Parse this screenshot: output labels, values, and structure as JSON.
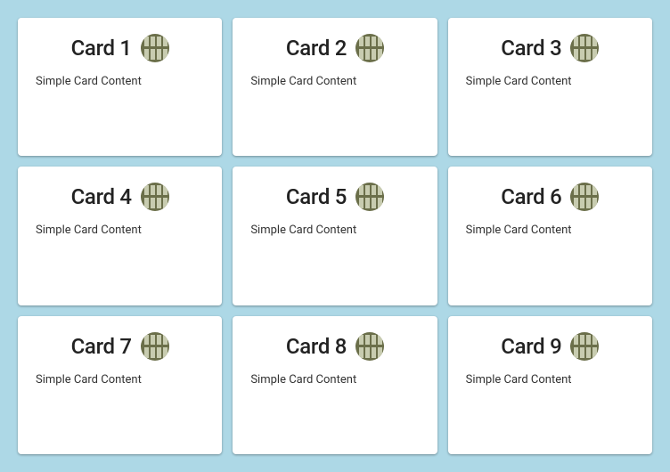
{
  "cards": [
    {
      "title": "Card 1",
      "content": "Simple Card Content",
      "avatar_icon": "window-pane-icon"
    },
    {
      "title": "Card 2",
      "content": "Simple Card Content",
      "avatar_icon": "window-pane-icon"
    },
    {
      "title": "Card 3",
      "content": "Simple Card Content",
      "avatar_icon": "window-pane-icon"
    },
    {
      "title": "Card 4",
      "content": "Simple Card Content",
      "avatar_icon": "window-pane-icon"
    },
    {
      "title": "Card 5",
      "content": "Simple Card Content",
      "avatar_icon": "window-pane-icon"
    },
    {
      "title": "Card 6",
      "content": "Simple Card Content",
      "avatar_icon": "window-pane-icon"
    },
    {
      "title": "Card 7",
      "content": "Simple Card Content",
      "avatar_icon": "window-pane-icon"
    },
    {
      "title": "Card 8",
      "content": "Simple Card Content",
      "avatar_icon": "window-pane-icon"
    },
    {
      "title": "Card 9",
      "content": "Simple Card Content",
      "avatar_icon": "window-pane-icon"
    }
  ]
}
